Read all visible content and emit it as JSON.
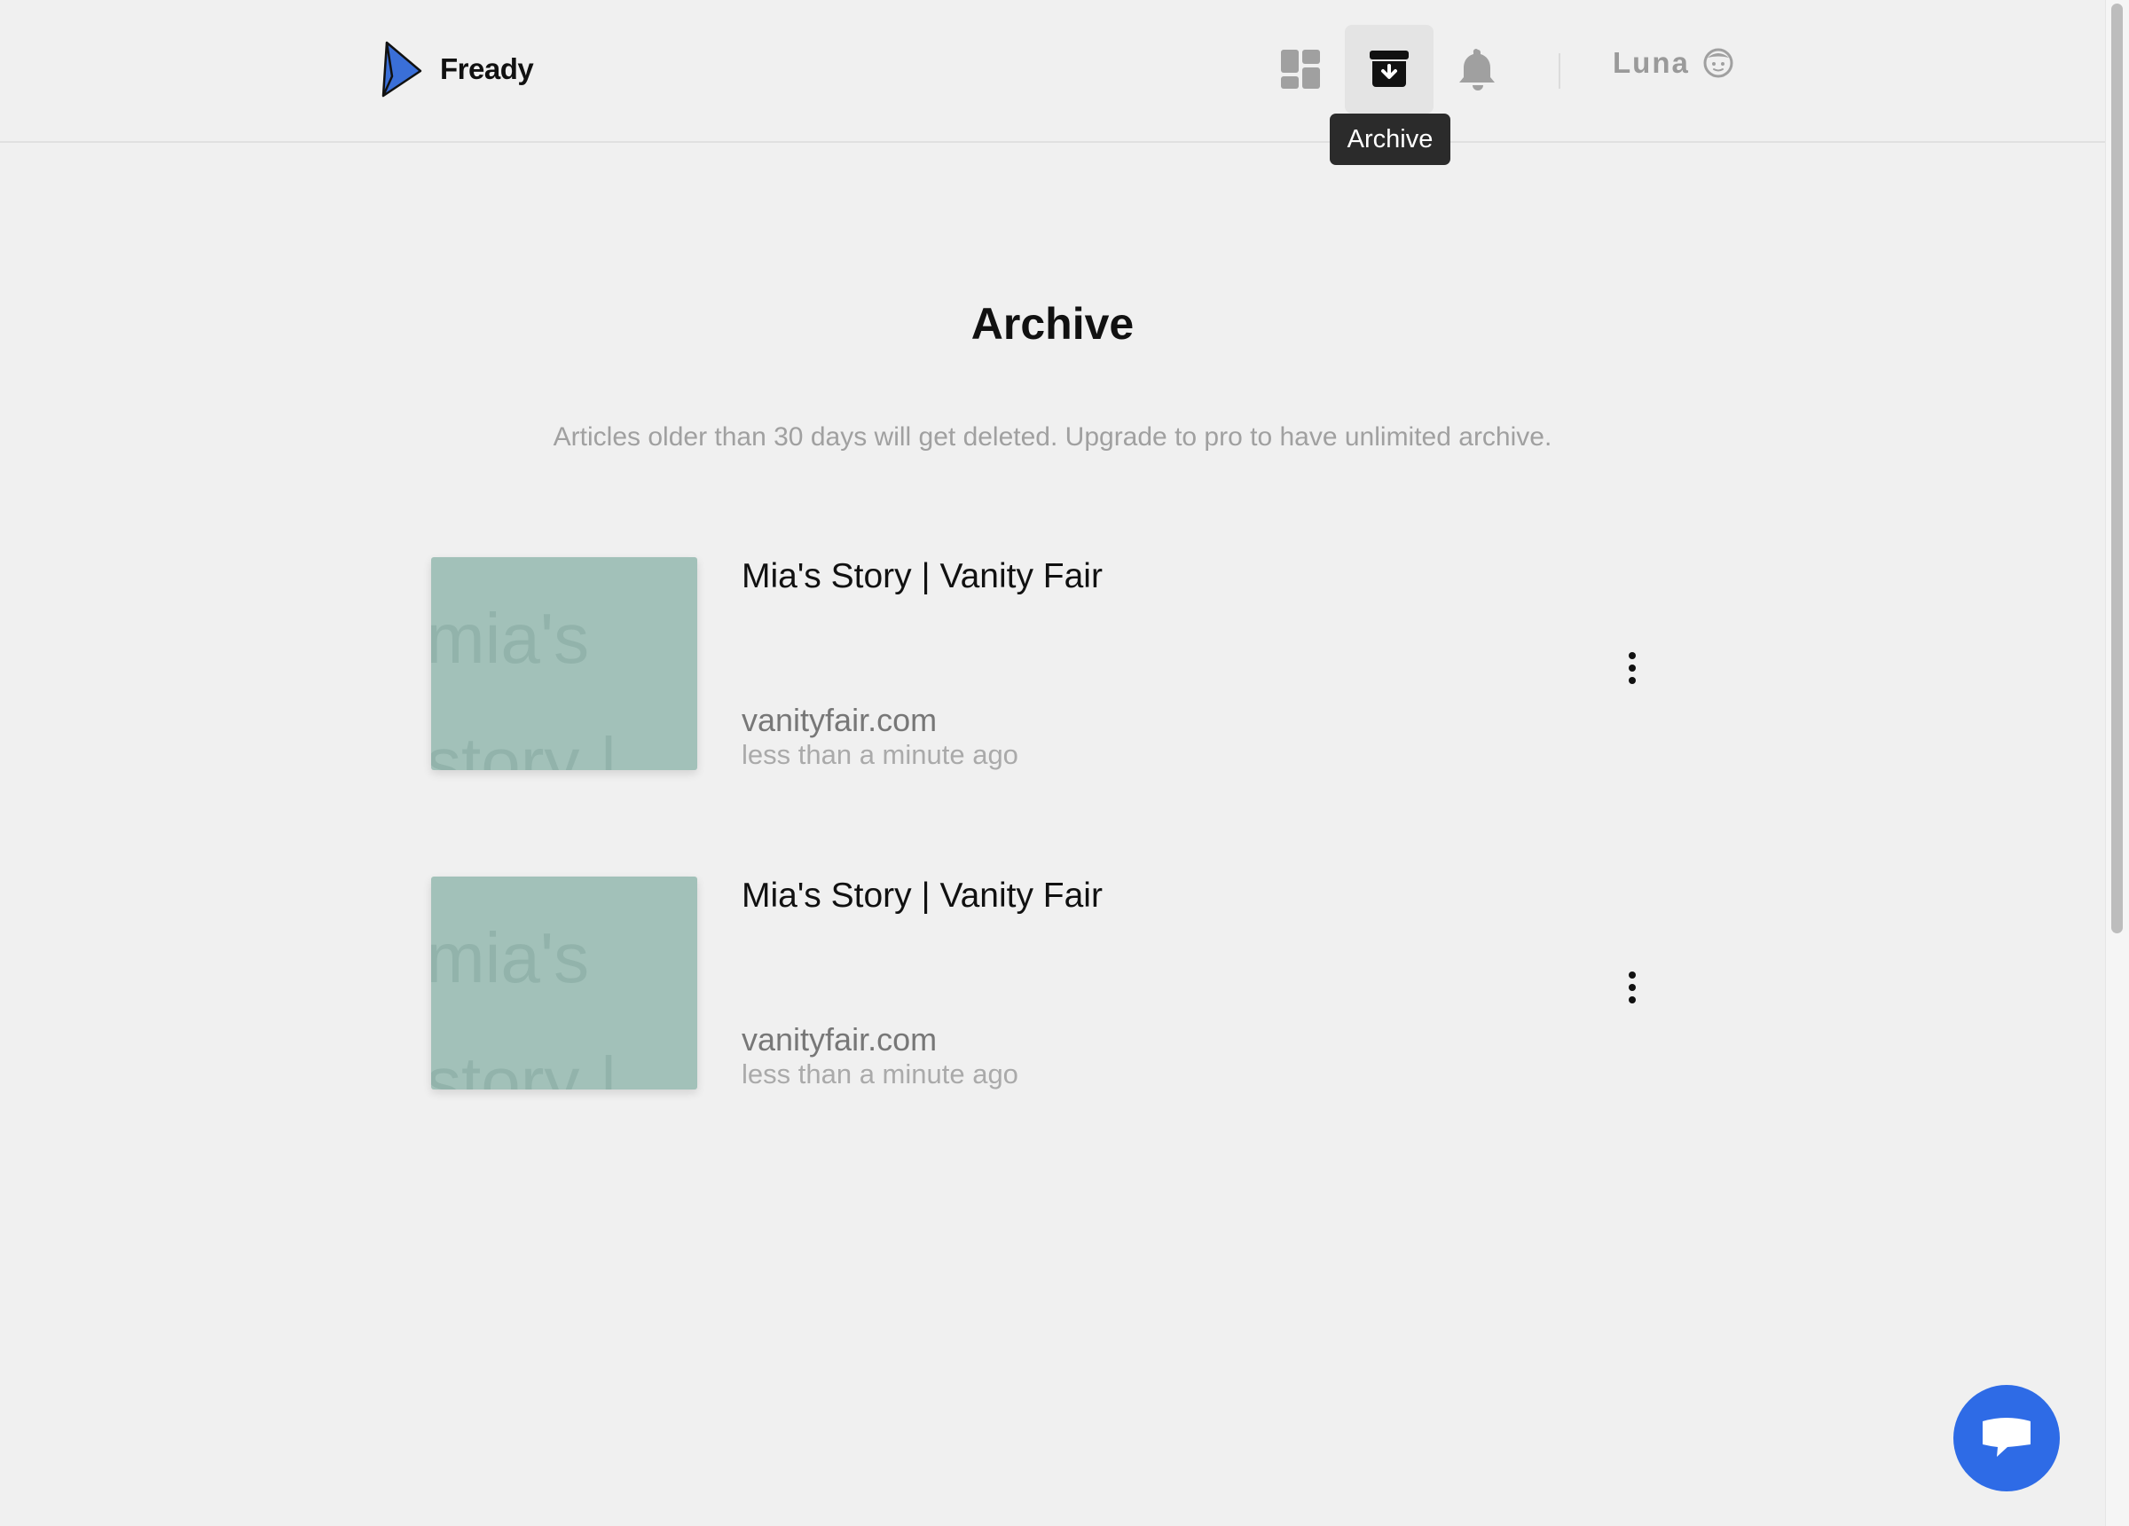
{
  "header": {
    "logo_text": "Fready",
    "nav": [
      {
        "icon": "dashboard-icon"
      },
      {
        "icon": "archive-icon",
        "active": true
      },
      {
        "icon": "bell-icon"
      }
    ],
    "user_name": "Luna"
  },
  "tooltip": "Archive",
  "main": {
    "title": "Archive",
    "subtitle": "Articles older than 30 days will get deleted. Upgrade to pro to have unlimited archive.",
    "articles": [
      {
        "title": "Mia's Story | Vanity Fair",
        "domain": "vanityfair.com",
        "time": "less than a minute ago",
        "thumbnail_text": "mia's story |"
      },
      {
        "title": "Mia's Story | Vanity Fair",
        "domain": "vanityfair.com",
        "time": "less than a minute ago",
        "thumbnail_text": "mia's story |"
      }
    ]
  },
  "colors": {
    "background": "#f0f0f0",
    "accent": "#2e6be6",
    "thumbnail": "#a2c1b9",
    "muted_text": "#a0a0a0"
  }
}
